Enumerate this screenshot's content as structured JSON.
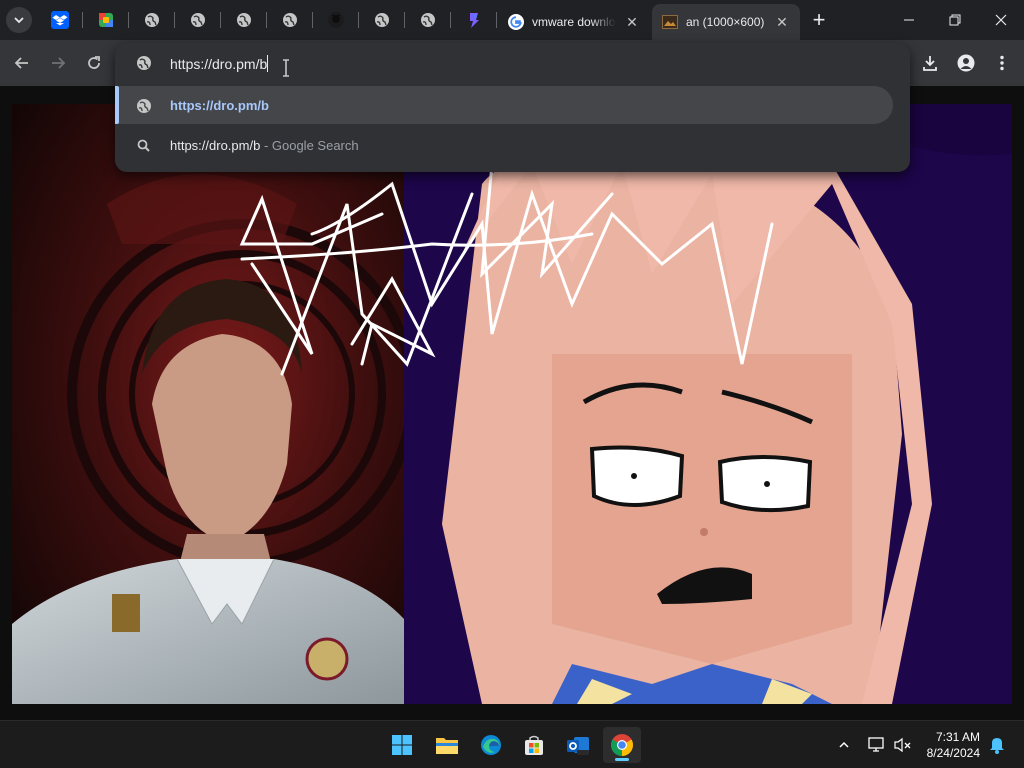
{
  "tabs": {
    "active_title": "an (1000×600)",
    "vmware_title": "vmware downlo",
    "close_glyph": "✕",
    "new_tab_glyph": "+"
  },
  "omnibox": {
    "input_value": "https://dro.pm/b",
    "suggestions": [
      {
        "text": "https://dro.pm/b",
        "sub": "",
        "icon": "globe-icon"
      },
      {
        "text": "https://dro.pm/b",
        "sub": " - Google Search",
        "icon": "search-icon"
      }
    ]
  },
  "clock": {
    "time": "7:31 AM",
    "date": "8/24/2024"
  },
  "colors": {
    "accent": "#a8c7fa",
    "taskbar_indicator": "#60cdff",
    "chrome_dark": "#202124"
  }
}
